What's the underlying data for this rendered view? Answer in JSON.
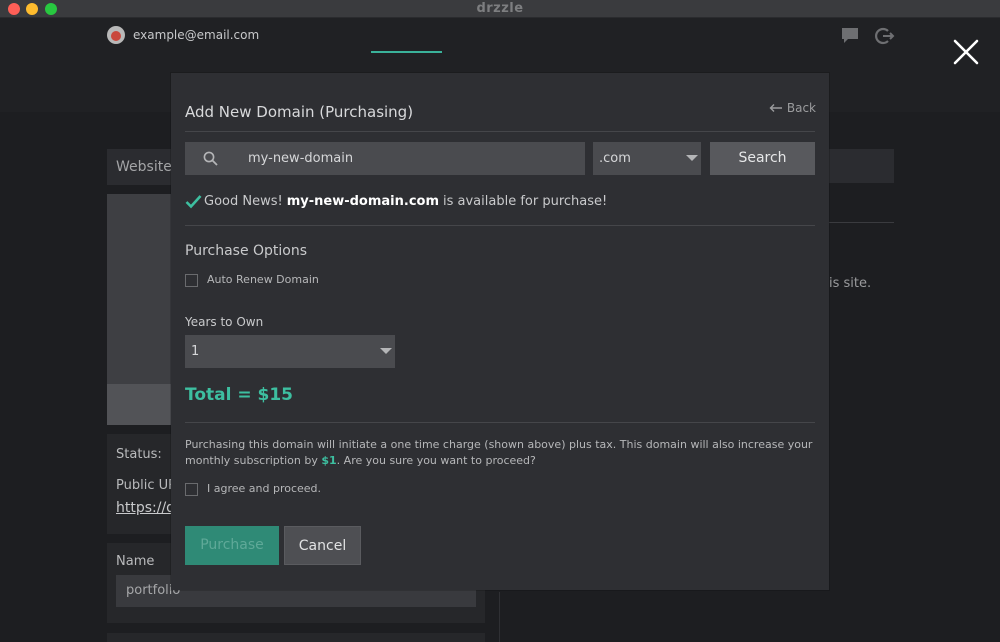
{
  "app": {
    "logo_text": "drzzle"
  },
  "header": {
    "email": "example@email.com"
  },
  "background": {
    "website_tab": "Website",
    "status_label": "Status:",
    "public_url_label": "Public UR",
    "url_text": "https://d",
    "name_label": "Name",
    "name_value": "portfolio",
    "right_text": "is site."
  },
  "modal": {
    "title": "Add New Domain (Purchasing)",
    "back_label": "Back",
    "search": {
      "value": "my-new-domain"
    },
    "tld": {
      "selected": ".com"
    },
    "search_button": "Search",
    "availability": {
      "prefix": "Good News!",
      "domain": "my-new-domain.com",
      "suffix": "is available for purchase!"
    },
    "purchase_options_title": "Purchase Options",
    "auto_renew_label": "Auto Renew Domain",
    "years_label": "Years to Own",
    "years_selected": "1",
    "total": "Total = $15",
    "disclaimer": {
      "before": "Purchasing this domain will initiate a one time charge (shown above) plus tax. This domain will also increase your monthly subscription by",
      "amount": "$1",
      "after": ". Are you sure you want to proceed?"
    },
    "agree_label": "I agree and proceed.",
    "purchase_button": "Purchase",
    "cancel_button": "Cancel"
  },
  "colors": {
    "accent": "#3dbfa0",
    "modal_bg": "#2e2f33",
    "page_bg": "#1d1e21"
  }
}
